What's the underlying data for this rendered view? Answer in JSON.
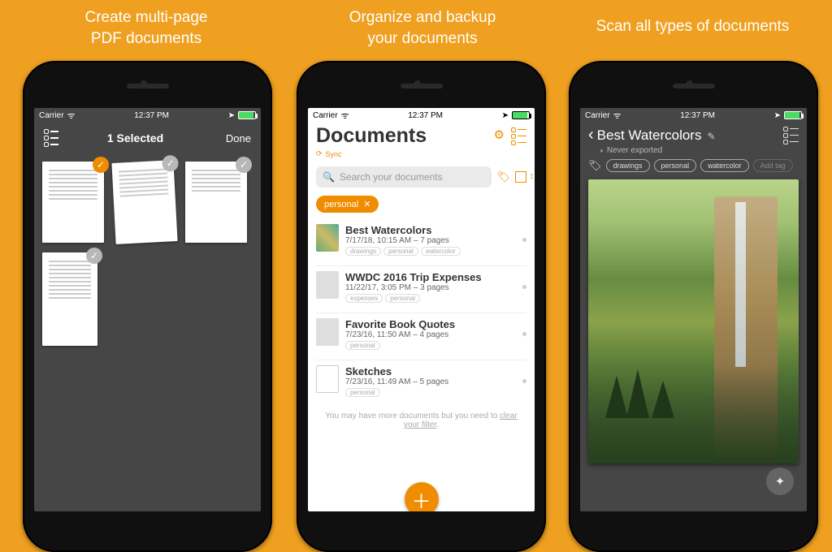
{
  "captions": {
    "c1": "Create multi-page\nPDF documents",
    "c2": "Organize and backup\nyour documents",
    "c3": "Scan all types of documents"
  },
  "status": {
    "carrier": "Carrier",
    "time": "12:37 PM"
  },
  "screen1": {
    "title": "1 Selected",
    "done": "Done"
  },
  "screen2": {
    "title": "Documents",
    "sync": "Sync",
    "search_placeholder": "Search your documents",
    "filter_chip": "personal",
    "docs": [
      {
        "title": "Best Watercolors",
        "sub": "7/17/18, 10:15 AM – 7 pages",
        "tags": [
          "drawings",
          "personal",
          "watercolor"
        ]
      },
      {
        "title": "WWDC 2016 Trip Expenses",
        "sub": "11/22/17, 3:05 PM – 3 pages",
        "tags": [
          "expenses",
          "personal"
        ]
      },
      {
        "title": "Favorite Book Quotes",
        "sub": "7/23/16, 11:50 AM – 4 pages",
        "tags": [
          "personal"
        ]
      },
      {
        "title": "Sketches",
        "sub": "7/23/16, 11:49 AM – 5 pages",
        "tags": [
          "personal"
        ]
      }
    ],
    "footer_a": "You may have more documents but you need to ",
    "footer_link": "clear your filter",
    "footer_b": "."
  },
  "screen3": {
    "title": "Best Watercolors",
    "subtitle": "Never exported",
    "tags": [
      "drawings",
      "personal",
      "watercolor"
    ],
    "add_tag": "Add tag"
  }
}
